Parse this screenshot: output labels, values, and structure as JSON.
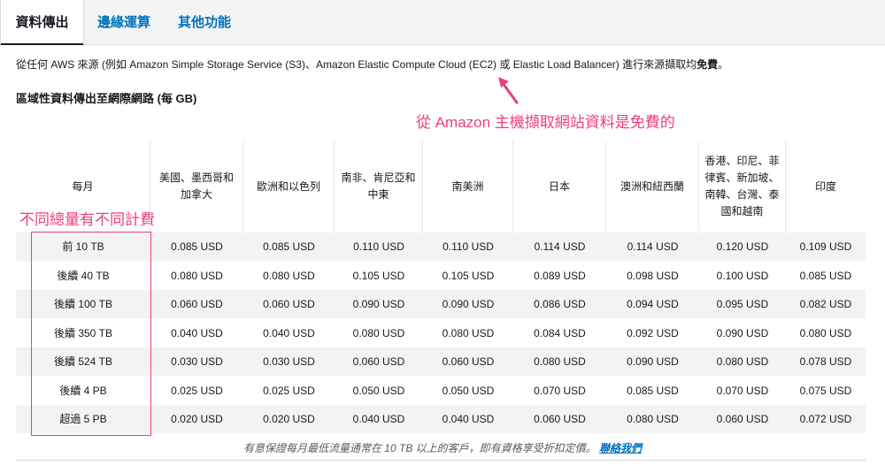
{
  "tabs": [
    {
      "label": "資料傳出",
      "active": true
    },
    {
      "label": "邊緣運算",
      "active": false
    },
    {
      "label": "其他功能",
      "active": false
    }
  ],
  "intro": {
    "text": "從任何 AWS 來源 (例如 Amazon Simple Storage Service (S3)、Amazon Elastic Compute Cloud (EC2) 或 Elastic Load Balancer) 進行來源擷取均",
    "bold": "免費",
    "end": "。"
  },
  "section_title": "區域性資料傳出至網際網路 (每 GB)",
  "annotations": {
    "free_note": "從 Amazon 主機擷取網站資料是免費的",
    "tier_note": "不同總量有不同計費"
  },
  "table": {
    "headers": [
      "每月",
      "美國、墨西哥和加拿大",
      "歐洲和以色列",
      "南非、肯尼亞和中東",
      "南美洲",
      "日本",
      "澳洲和紐西蘭",
      "香港、印尼、菲律賓、新加坡、南韓、台灣、泰國和越南",
      "印度"
    ],
    "rows": [
      [
        "前 10 TB",
        "0.085 USD",
        "0.085 USD",
        "0.110 USD",
        "0.110 USD",
        "0.114 USD",
        "0.114 USD",
        "0.120 USD",
        "0.109 USD"
      ],
      [
        "後續 40 TB",
        "0.080 USD",
        "0.080 USD",
        "0.105 USD",
        "0.105 USD",
        "0.089 USD",
        "0.098 USD",
        "0.100 USD",
        "0.085 USD"
      ],
      [
        "後續 100 TB",
        "0.060 USD",
        "0.060 USD",
        "0.090 USD",
        "0.090 USD",
        "0.086 USD",
        "0.094 USD",
        "0.095 USD",
        "0.082 USD"
      ],
      [
        "後續 350 TB",
        "0.040 USD",
        "0.040 USD",
        "0.080 USD",
        "0.080 USD",
        "0.084 USD",
        "0.092 USD",
        "0.090 USD",
        "0.080 USD"
      ],
      [
        "後續 524 TB",
        "0.030 USD",
        "0.030 USD",
        "0.060 USD",
        "0.060 USD",
        "0.080 USD",
        "0.090 USD",
        "0.080 USD",
        "0.078 USD"
      ],
      [
        "後續 4 PB",
        "0.025 USD",
        "0.025 USD",
        "0.050 USD",
        "0.050 USD",
        "0.070 USD",
        "0.085 USD",
        "0.070 USD",
        "0.075 USD"
      ],
      [
        "超過 5 PB",
        "0.020 USD",
        "0.020 USD",
        "0.040 USD",
        "0.040 USD",
        "0.060 USD",
        "0.080 USD",
        "0.060 USD",
        "0.072 USD"
      ]
    ]
  },
  "footnote": {
    "text": "有意保證每月最低流量通常在 10 TB 以上的客戶，即有資格享受折扣定價。",
    "link": "聯絡我們"
  },
  "colors": {
    "accent": "#ec407a",
    "link": "#0073bb",
    "text": "#16191f",
    "row_stripe": "#f2f3f3"
  }
}
